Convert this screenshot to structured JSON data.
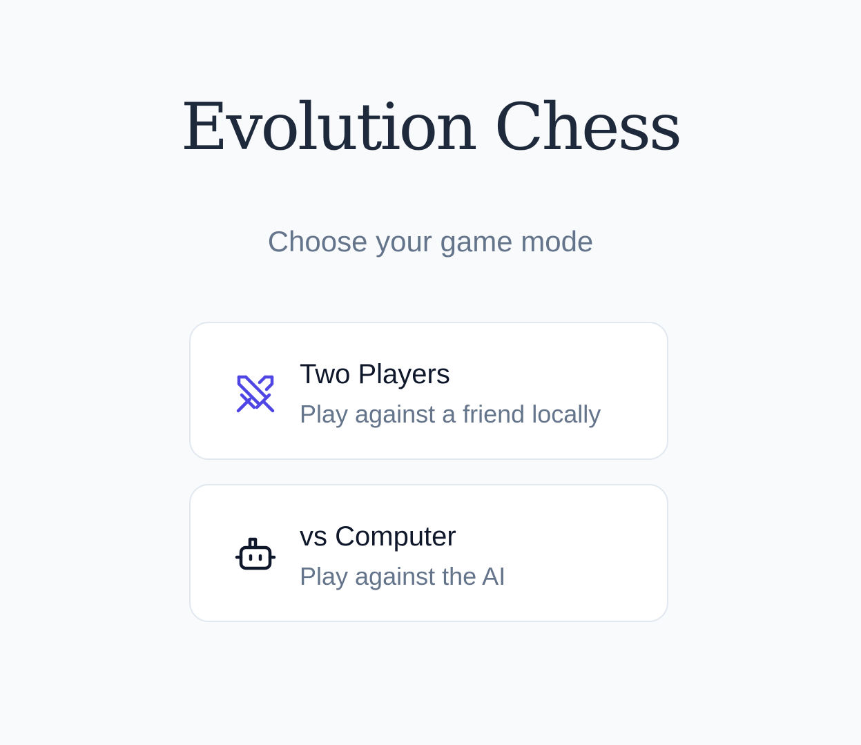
{
  "app": {
    "title": "Evolution Chess",
    "subtitle": "Choose your game mode"
  },
  "modes": [
    {
      "title": "Two Players",
      "description": "Play against a friend locally",
      "icon": "crossed-swords-icon",
      "icon_color": "#4f46e5"
    },
    {
      "title": "vs Computer",
      "description": "Play against the AI",
      "icon": "robot-icon",
      "icon_color": "#0f172a"
    }
  ],
  "colors": {
    "background": "#f8fafc",
    "card_background": "#ffffff",
    "card_border": "#e2e8f0",
    "title": "#1e293b",
    "muted_text": "#64748b",
    "accent": "#4f46e5"
  }
}
